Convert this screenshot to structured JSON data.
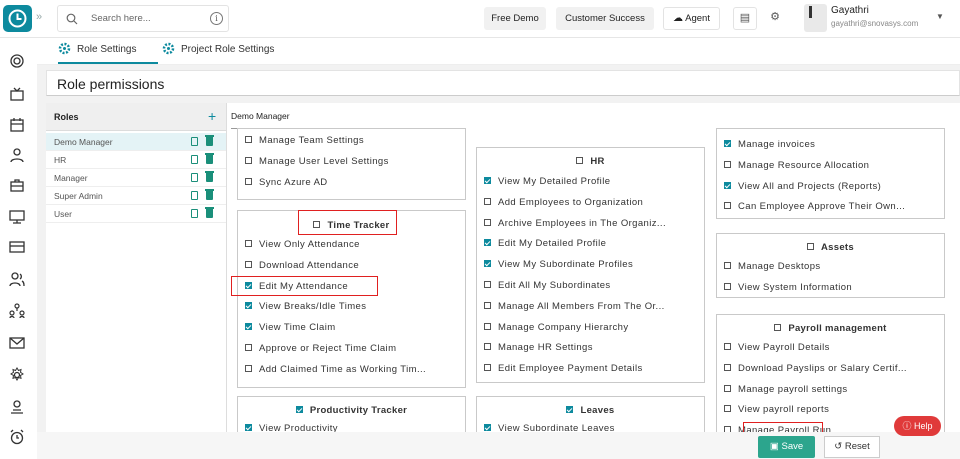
{
  "search": {
    "placeholder": "Search here..."
  },
  "topbar": {
    "free_demo": "Free Demo",
    "customer_success": "Customer Success",
    "agent": "Agent"
  },
  "user": {
    "name": "Gayathri",
    "email": "gayathri@snovasys.com"
  },
  "tabs": [
    {
      "label": "Role Settings"
    },
    {
      "label": "Project Role Settings"
    }
  ],
  "page_title": "Role permissions",
  "roles": {
    "header": "Roles",
    "items": [
      {
        "label": "Demo Manager"
      },
      {
        "label": "HR"
      },
      {
        "label": "Manager"
      },
      {
        "label": "Super Admin"
      },
      {
        "label": "User"
      }
    ]
  },
  "selected_role": "Demo Manager",
  "cards": {
    "general": {
      "items": [
        {
          "label": "Manage Team Settings",
          "checked": false
        },
        {
          "label": "Manage User Level Settings",
          "checked": false
        },
        {
          "label": "Sync Azure AD",
          "checked": false
        }
      ]
    },
    "time_tracker": {
      "title": "Time Tracker",
      "checked": false,
      "items": [
        {
          "label": "View Only Attendance",
          "checked": false
        },
        {
          "label": "Download Attendance",
          "checked": false
        },
        {
          "label": "Edit My Attendance",
          "checked": true
        },
        {
          "label": "View Breaks/Idle Times",
          "checked": true
        },
        {
          "label": "View Time Claim",
          "checked": true
        },
        {
          "label": "Approve or Reject Time Claim",
          "checked": false
        },
        {
          "label": "Add Claimed Time as Working Tim...",
          "checked": false
        }
      ]
    },
    "productivity": {
      "title": "Productivity Tracker",
      "checked": true,
      "items": [
        {
          "label": "View Productivity",
          "checked": true
        }
      ]
    },
    "hr": {
      "title": "HR",
      "checked": false,
      "items": [
        {
          "label": "View My Detailed Profile",
          "checked": true
        },
        {
          "label": "Add Employees to Organization",
          "checked": false
        },
        {
          "label": "Archive Employees in The Organiz...",
          "checked": false
        },
        {
          "label": "Edit My Detailed Profile",
          "checked": true
        },
        {
          "label": "View My Subordinate Profiles",
          "checked": true
        },
        {
          "label": "Edit All My Subordinates",
          "checked": false
        },
        {
          "label": "Manage All Members From The Or...",
          "checked": false
        },
        {
          "label": "Manage Company Hierarchy",
          "checked": false
        },
        {
          "label": "Manage HR Settings",
          "checked": false
        },
        {
          "label": "Edit Employee Payment Details",
          "checked": false
        }
      ]
    },
    "leaves": {
      "title": "Leaves",
      "checked": true,
      "items": [
        {
          "label": "View Subordinate Leaves",
          "checked": true
        }
      ]
    },
    "projects": {
      "items": [
        {
          "label": "Manage invoices",
          "checked": true
        },
        {
          "label": "Manage Resource Allocation",
          "checked": false
        },
        {
          "label": "View All and Projects (Reports)",
          "checked": true
        },
        {
          "label": "Can Employee Approve Their Own...",
          "checked": false
        }
      ]
    },
    "assets": {
      "title": "Assets",
      "checked": false,
      "items": [
        {
          "label": "Manage Desktops",
          "checked": false
        },
        {
          "label": "View System Information",
          "checked": false
        }
      ]
    },
    "payroll": {
      "title": "Payroll management",
      "checked": false,
      "items": [
        {
          "label": "View Payroll Details",
          "checked": false
        },
        {
          "label": "Download Payslips or Salary Certif...",
          "checked": false
        },
        {
          "label": "Manage payroll settings",
          "checked": false
        },
        {
          "label": "View payroll reports",
          "checked": false
        },
        {
          "label": "Manage Payroll Run",
          "checked": false
        }
      ]
    }
  },
  "footer": {
    "save": "Save",
    "reset": "Reset"
  },
  "help": "Help",
  "colors": {
    "accent": "#0d8a9e",
    "save": "#2ca58d",
    "help": "#e03a3a",
    "highlight": "#e02020"
  }
}
